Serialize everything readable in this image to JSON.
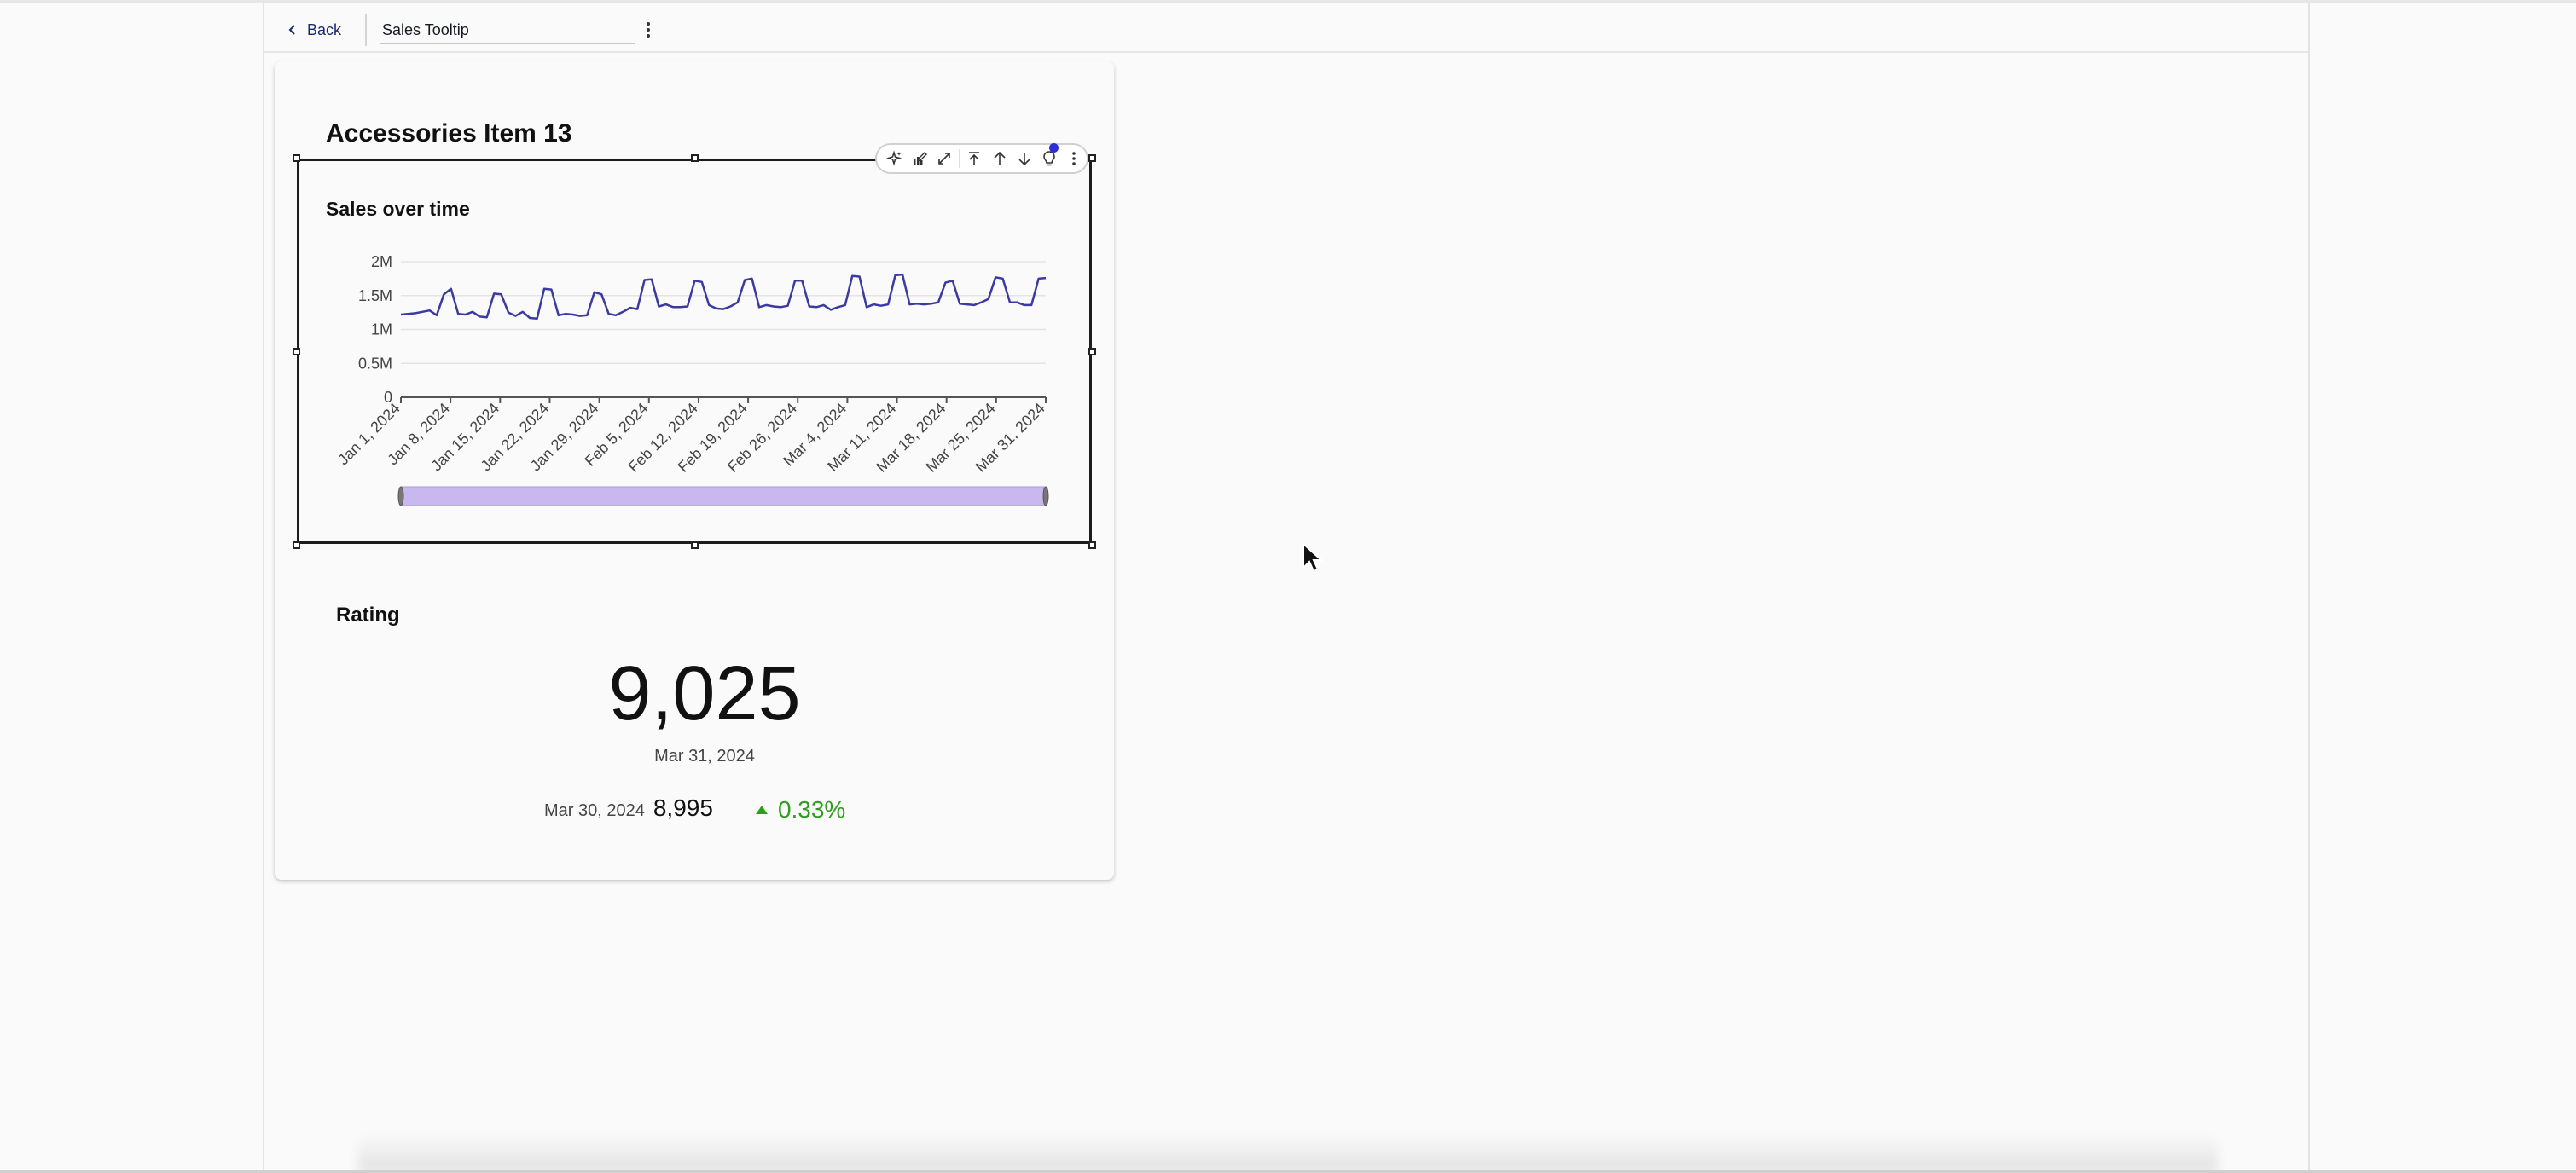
{
  "toolbar": {
    "back_label": "Back",
    "title_value": "Sales Tooltip"
  },
  "card": {
    "title": "Accessories Item 13"
  },
  "visual_toolbar": {
    "icons": [
      "ai-sparkle-icon",
      "edit-chart-icon",
      "expand-icon",
      "move-top-icon",
      "move-up-icon",
      "move-down-icon",
      "insight-lightbulb-icon",
      "more-options-icon"
    ]
  },
  "sales_chart": {
    "title": "Sales over time",
    "accent_color": "#3b3aa0",
    "slider_color": "#c9b8f0"
  },
  "chart_data": {
    "type": "line",
    "title": "Sales over time",
    "xlabel": "",
    "ylabel": "",
    "ylim": [
      0,
      2000000
    ],
    "y_ticks": [
      {
        "value": 0,
        "label": "0"
      },
      {
        "value": 500000,
        "label": "0.5M"
      },
      {
        "value": 1000000,
        "label": "1M"
      },
      {
        "value": 1500000,
        "label": "1.5M"
      },
      {
        "value": 2000000,
        "label": "2M"
      }
    ],
    "x_tick_labels": [
      "Jan 1, 2024",
      "Jan 8, 2024",
      "Jan 15, 2024",
      "Jan 22, 2024",
      "Jan 29, 2024",
      "Feb 5, 2024",
      "Feb 12, 2024",
      "Feb 19, 2024",
      "Feb 26, 2024",
      "Mar 4, 2024",
      "Mar 11, 2024",
      "Mar 18, 2024",
      "Mar 25, 2024",
      "Mar 31, 2024"
    ],
    "x_range": [
      "2024-01-01",
      "2024-03-31"
    ],
    "grid": true,
    "series": [
      {
        "x": [
          "2024-01-01",
          "2024-01-02",
          "2024-01-03",
          "2024-01-04",
          "2024-01-05",
          "2024-01-06",
          "2024-01-07",
          "2024-01-08",
          "2024-01-09",
          "2024-01-10",
          "2024-01-11",
          "2024-01-12",
          "2024-01-13",
          "2024-01-14",
          "2024-01-15",
          "2024-01-16",
          "2024-01-17",
          "2024-01-18",
          "2024-01-19",
          "2024-01-20",
          "2024-01-21",
          "2024-01-22",
          "2024-01-23",
          "2024-01-24",
          "2024-01-25",
          "2024-01-26",
          "2024-01-27",
          "2024-01-28",
          "2024-01-29",
          "2024-01-30",
          "2024-01-31",
          "2024-02-01",
          "2024-02-02",
          "2024-02-03",
          "2024-02-04",
          "2024-02-05",
          "2024-02-06",
          "2024-02-07",
          "2024-02-08",
          "2024-02-09",
          "2024-02-10",
          "2024-02-11",
          "2024-02-12",
          "2024-02-13",
          "2024-02-14",
          "2024-02-15",
          "2024-02-16",
          "2024-02-17",
          "2024-02-18",
          "2024-02-19",
          "2024-02-20",
          "2024-02-21",
          "2024-02-22",
          "2024-02-23",
          "2024-02-24",
          "2024-02-25",
          "2024-02-26",
          "2024-02-27",
          "2024-02-28",
          "2024-02-29",
          "2024-03-01",
          "2024-03-02",
          "2024-03-03",
          "2024-03-04",
          "2024-03-05",
          "2024-03-06",
          "2024-03-07",
          "2024-03-08",
          "2024-03-09",
          "2024-03-10",
          "2024-03-11",
          "2024-03-12",
          "2024-03-13",
          "2024-03-14",
          "2024-03-15",
          "2024-03-16",
          "2024-03-17",
          "2024-03-18",
          "2024-03-19",
          "2024-03-20",
          "2024-03-21",
          "2024-03-22",
          "2024-03-23",
          "2024-03-24",
          "2024-03-25",
          "2024-03-26",
          "2024-03-27",
          "2024-03-28",
          "2024-03-29",
          "2024-03-30",
          "2024-03-31"
        ],
        "values": [
          1220000,
          1230000,
          1240000,
          1260000,
          1280000,
          1210000,
          1520000,
          1600000,
          1230000,
          1220000,
          1260000,
          1190000,
          1180000,
          1530000,
          1520000,
          1250000,
          1200000,
          1260000,
          1170000,
          1160000,
          1600000,
          1590000,
          1210000,
          1230000,
          1220000,
          1200000,
          1210000,
          1550000,
          1520000,
          1230000,
          1210000,
          1260000,
          1320000,
          1300000,
          1730000,
          1740000,
          1340000,
          1370000,
          1330000,
          1330000,
          1340000,
          1720000,
          1700000,
          1360000,
          1310000,
          1300000,
          1340000,
          1400000,
          1730000,
          1750000,
          1330000,
          1360000,
          1340000,
          1330000,
          1350000,
          1720000,
          1720000,
          1340000,
          1330000,
          1360000,
          1290000,
          1330000,
          1360000,
          1790000,
          1780000,
          1330000,
          1370000,
          1350000,
          1370000,
          1800000,
          1810000,
          1370000,
          1380000,
          1370000,
          1380000,
          1400000,
          1690000,
          1720000,
          1380000,
          1370000,
          1360000,
          1400000,
          1450000,
          1770000,
          1750000,
          1400000,
          1400000,
          1360000,
          1360000,
          1750000,
          1760000
        ]
      }
    ]
  },
  "rating": {
    "title": "Rating",
    "value": "9,025",
    "date": "Mar 31, 2024",
    "compare_date": "Mar 30, 2024",
    "compare_value": "8,995",
    "delta": "0.33%",
    "delta_color": "#2e9d1e"
  }
}
